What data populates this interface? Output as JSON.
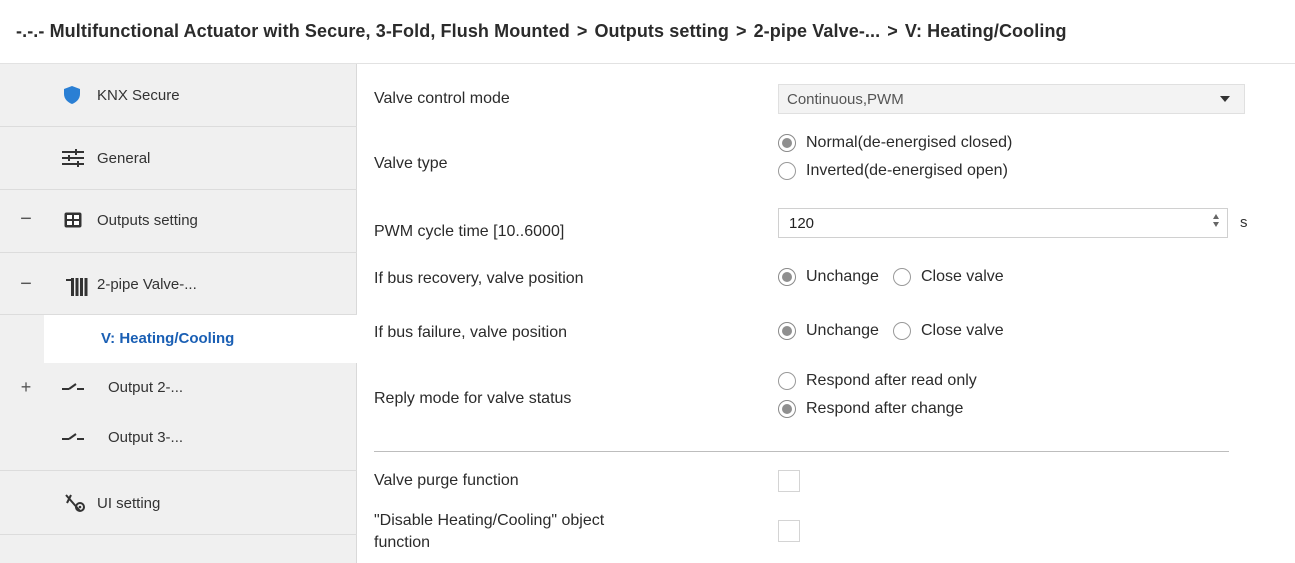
{
  "breadcrumb": {
    "items": [
      "-.-.- Multifunctional Actuator with Secure, 3-Fold, Flush Mounted",
      "Outputs setting",
      "2-pipe Valve-...",
      "V: Heating/Cooling"
    ],
    "separator": ">"
  },
  "sidebar": {
    "items": [
      {
        "label": "KNX Secure",
        "icon": "shield-icon"
      },
      {
        "label": "General",
        "icon": "sliders-icon"
      },
      {
        "label": "Outputs setting",
        "icon": "grid-box-icon",
        "toggle": "−"
      },
      {
        "label": "2-pipe Valve-...",
        "icon": "radiator-icon",
        "toggle": "−"
      },
      {
        "label": "V: Heating/Cooling",
        "selected": true
      },
      {
        "label": "Output 2-...",
        "icon": "switch-contact-icon",
        "toggle": "+"
      },
      {
        "label": "Output 3-...",
        "icon": "switch-contact-icon"
      },
      {
        "label": "UI setting",
        "icon": "ui-setting-icon"
      }
    ]
  },
  "params": {
    "valve_control_mode": {
      "label": "Valve control mode",
      "value": "Continuous,PWM"
    },
    "valve_type": {
      "label": "Valve type",
      "options": [
        "Normal(de-energised closed)",
        "Inverted(de-energised open)"
      ],
      "selected": 0
    },
    "pwm_cycle": {
      "label": "PWM cycle time [10..6000]",
      "value": "120",
      "unit": "s"
    },
    "bus_recovery": {
      "label": "If bus recovery, valve position",
      "options": [
        "Unchange",
        "Close valve"
      ],
      "selected": 0
    },
    "bus_failure": {
      "label": "If bus failure, valve position",
      "options": [
        "Unchange",
        "Close valve"
      ],
      "selected": 0
    },
    "reply_mode": {
      "label": "Reply mode for valve status",
      "options": [
        "Respond after read only",
        "Respond after change"
      ],
      "selected": 1
    },
    "valve_purge": {
      "label": "Valve purge function",
      "checked": false
    },
    "disable_hc": {
      "label_line1": "\"Disable Heating/Cooling\" object",
      "label_line2": "function",
      "checked": false
    }
  },
  "colors": {
    "accent": "#1a5fb4",
    "sidebar_bg": "#f0f0f0",
    "shield": "#2a7fd4"
  }
}
